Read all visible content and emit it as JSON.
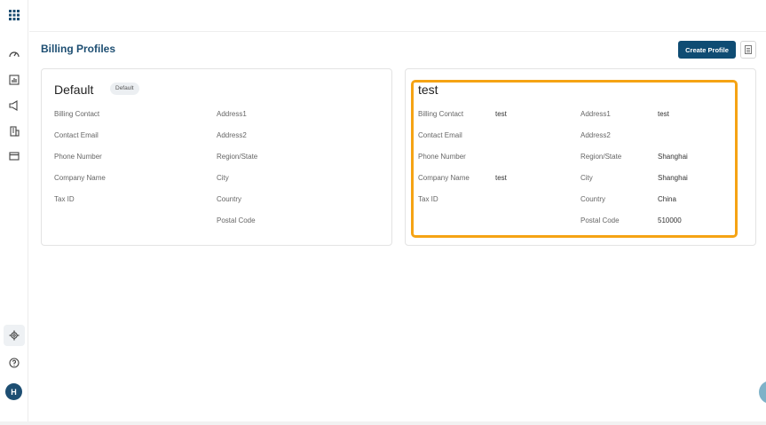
{
  "page": {
    "title": "Billing Profiles"
  },
  "header": {
    "create_label": "Create Profile"
  },
  "sidebar": {
    "icons": [
      "grid-icon",
      "dashboard-icon",
      "chart-icon",
      "megaphone-icon",
      "building-icon",
      "card-icon",
      "gear-icon",
      "help-icon"
    ],
    "avatar_initial": "H"
  },
  "profiles": [
    {
      "name": "Default",
      "badge": "Default",
      "labels": {
        "billing_contact": "Billing Contact",
        "contact_email": "Contact Email",
        "phone_number": "Phone Number",
        "company_name": "Company Name",
        "tax_id": "Tax ID",
        "address1": "Address1",
        "address2": "Address2",
        "region_state": "Region/State",
        "city": "City",
        "country": "Country",
        "postal_code": "Postal Code"
      },
      "values": {
        "billing_contact": "",
        "contact_email": "",
        "phone_number": "",
        "company_name": "",
        "tax_id": "",
        "address1": "",
        "address2": "",
        "region_state": "",
        "city": "",
        "country": "",
        "postal_code": ""
      }
    },
    {
      "name": "test",
      "labels": {
        "billing_contact": "Billing Contact",
        "contact_email": "Contact Email",
        "phone_number": "Phone Number",
        "company_name": "Company Name",
        "tax_id": "Tax ID",
        "address1": "Address1",
        "address2": "Address2",
        "region_state": "Region/State",
        "city": "City",
        "country": "Country",
        "postal_code": "Postal Code"
      },
      "values": {
        "billing_contact": "test",
        "contact_email": "",
        "phone_number": "",
        "company_name": "test",
        "tax_id": "",
        "address1": "test",
        "address2": "",
        "region_state": "Shanghai",
        "city": "Shanghai",
        "country": "China",
        "postal_code": "510000"
      }
    }
  ],
  "colors": {
    "accent": "#0f4c73",
    "title": "#1d4e72",
    "highlight": "#f5a314"
  }
}
